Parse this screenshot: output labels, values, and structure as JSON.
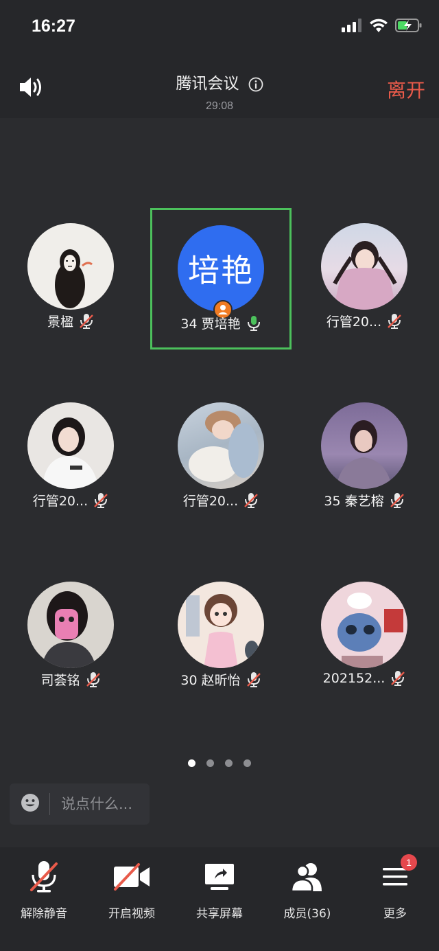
{
  "status_bar": {
    "time": "16:27"
  },
  "header": {
    "title": "腾讯会议",
    "timer": "29:08",
    "leave_label": "离开"
  },
  "participants": [
    {
      "name": "景楹",
      "mic": "muted",
      "avatar": "no-face-avatar"
    },
    {
      "name": "34 贾培艳",
      "mic": "on",
      "avatar_text": "培艳",
      "host": true,
      "active": true
    },
    {
      "name": "行管20...",
      "mic": "muted",
      "avatar": "girl-braids-photo"
    },
    {
      "name": "行管20...",
      "mic": "muted",
      "avatar": "girl-white-hoodie-photo"
    },
    {
      "name": "行管20...",
      "mic": "muted",
      "avatar": "girl-lying-cat-photo"
    },
    {
      "name": "35 秦艺榕",
      "mic": "muted",
      "avatar": "girl-purple-sky-photo"
    },
    {
      "name": "司荟铭",
      "mic": "muted",
      "avatar": "girl-pink-phone-photo"
    },
    {
      "name": "30 赵昕怡",
      "mic": "muted",
      "avatar": "cartoon-girl-avatar"
    },
    {
      "name": "202152...",
      "mic": "muted",
      "avatar": "stitch-cartoon-avatar"
    }
  ],
  "pagination": {
    "pages": 4,
    "current": 1
  },
  "chat": {
    "placeholder": "说点什么..."
  },
  "toolbar": {
    "unmute_label": "解除静音",
    "video_label": "开启视频",
    "share_label": "共享屏幕",
    "members_label": "成员(36)",
    "more_label": "更多",
    "more_badge": "1"
  },
  "colors": {
    "leave": "#e85a4a",
    "active_border": "#4cc15c",
    "avatar_blue": "#2f6df0",
    "badge_red": "#e5484d"
  }
}
